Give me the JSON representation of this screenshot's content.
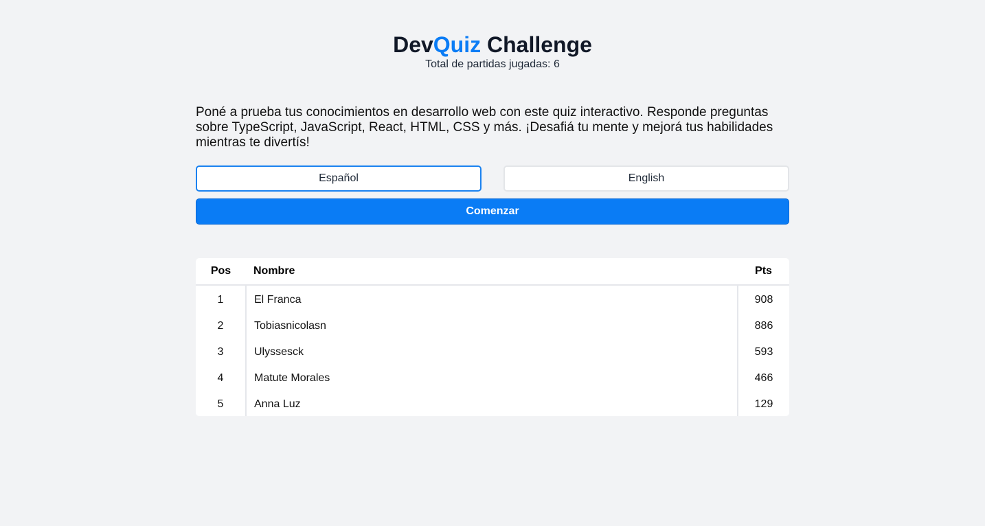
{
  "header": {
    "title_part1": "Dev",
    "title_accent": "Quiz",
    "title_part2": " Challenge",
    "subtitle": "Total de partidas jugadas: 6"
  },
  "intro": {
    "description": "Poné a prueba tus conocimientos en desarrollo web con este quiz interactivo. Responde preguntas sobre TypeScript, JavaScript, React, HTML, CSS y más. ¡Desafiá tu mente y mejorá tus habilidades mientras te divertís!"
  },
  "languages": {
    "spanish_label": "Español",
    "english_label": "English",
    "selected": "Español"
  },
  "start_button": {
    "label": "Comenzar"
  },
  "leaderboard": {
    "headers": {
      "pos": "Pos",
      "name": "Nombre",
      "pts": "Pts"
    },
    "rows": [
      {
        "pos": "1",
        "name": "El Franca",
        "pts": "908"
      },
      {
        "pos": "2",
        "name": "Tobiasnicolasn",
        "pts": "886"
      },
      {
        "pos": "3",
        "name": "Ulyssesck",
        "pts": "593"
      },
      {
        "pos": "4",
        "name": "Matute Morales",
        "pts": "466"
      },
      {
        "pos": "5",
        "name": "Anna Luz",
        "pts": "129"
      }
    ]
  },
  "colors": {
    "accent": "#0a7cf5",
    "background": "#f2f3f5",
    "selected_border": "#1a82f0"
  }
}
